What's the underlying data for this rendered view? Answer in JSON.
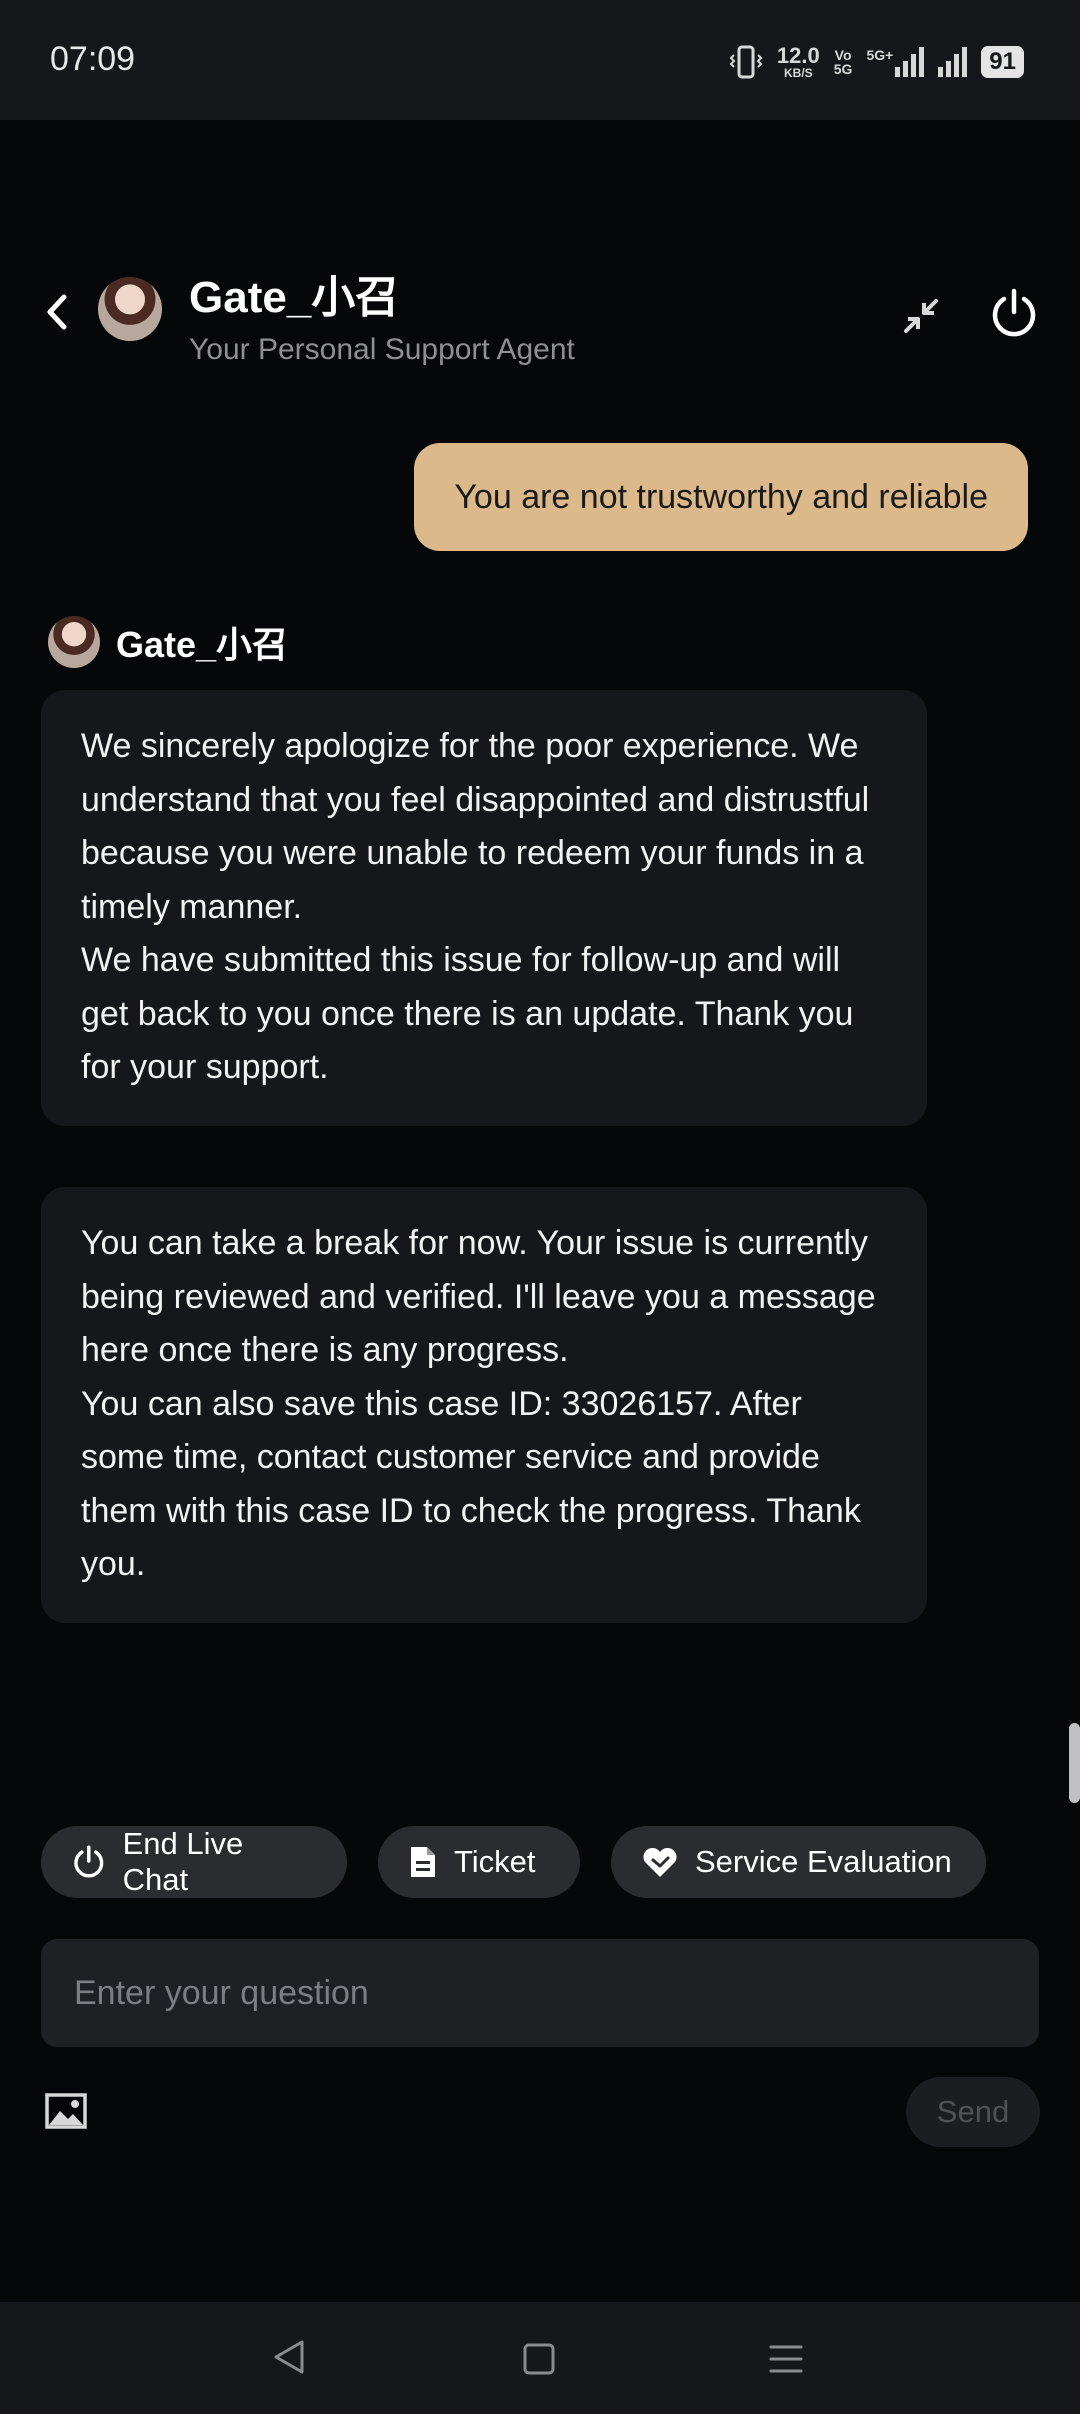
{
  "status_bar": {
    "time": "07:09",
    "net_speed_value": "12.0",
    "net_speed_unit": "KB/S",
    "volte_top": "Vo",
    "volte_bottom": "5G",
    "network_type": "5G+",
    "battery": "91"
  },
  "header": {
    "agent_name": "Gate_小召",
    "agent_subtitle": "Your Personal Support Agent"
  },
  "messages": {
    "user_message": "You are not trustworthy and reliable",
    "agent_label": "Gate_小召",
    "agent_1": {
      "p1": "We sincerely apologize for the poor experience. We understand that you feel disappointed and distrustful because you were unable to redeem your funds in a timely manner.",
      "p2": "We have submitted this issue for follow-up and will get back to you once there is an update. Thank you for your support."
    },
    "agent_2": {
      "p1": "You can take a break for now. Your issue is currently being reviewed and verified. I'll leave you a message here once there is any progress.",
      "p2": "You can also save this case ID: 33026157. After some time, contact customer service and provide them with this case ID to check the progress. Thank you."
    }
  },
  "actions": {
    "end_chat": "End Live Chat",
    "ticket": "Ticket",
    "evaluation": "Service Evaluation"
  },
  "composer": {
    "placeholder": "Enter your question",
    "send": "Send"
  },
  "colors": {
    "user_bubble": "#dcb98a",
    "agent_bubble": "#16171b",
    "background": "#060708"
  }
}
